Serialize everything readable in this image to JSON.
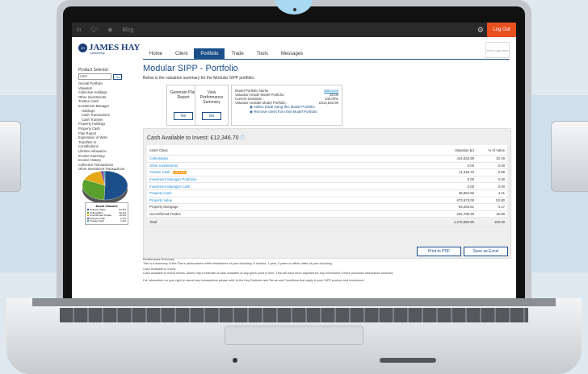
{
  "topbar": {
    "blog": "Blog",
    "logout": "Log Out",
    "social_icons": [
      "in",
      "twitter",
      "instagram"
    ]
  },
  "brand": {
    "name": "JAMES HAY",
    "sub": "partnership",
    "badge": "JH"
  },
  "nav": {
    "tabs": [
      "Home",
      "Client",
      "Portfolio",
      "Trade",
      "Tools",
      "Messages"
    ],
    "active": "Portfolio"
  },
  "your_logo": "Your Logo Here",
  "sidebar": {
    "product_selector_label": "Product Selector:",
    "selected_product": "SIPP",
    "go": "Go",
    "items": [
      {
        "label": "Overall Portfolio",
        "indent": false
      },
      {
        "label": "Valuation",
        "indent": false
      },
      {
        "label": "Collective Holdings",
        "indent": false
      },
      {
        "label": "Other Investments",
        "indent": false
      },
      {
        "label": "Trustee Cash",
        "indent": false
      },
      {
        "label": "Investment Manager",
        "indent": false
      },
      {
        "label": "Holdings",
        "indent": true
      },
      {
        "label": "Cash Transactions",
        "indent": true
      },
      {
        "label": "Cash Transfer",
        "indent": true
      },
      {
        "label": "Property Holdings",
        "indent": false
      },
      {
        "label": "Property Cash",
        "indent": false
      },
      {
        "label": "Plan Report",
        "indent": false
      },
      {
        "label": "Expression of Wish",
        "indent": false
      },
      {
        "label": "Transfers In",
        "indent": false
      },
      {
        "label": "Contributions",
        "indent": false
      },
      {
        "label": "Lifetime Allowance",
        "indent": false
      },
      {
        "label": "Income Summary",
        "indent": false
      },
      {
        "label": "Income History",
        "indent": false
      },
      {
        "label": "Collective Transactions",
        "indent": false
      },
      {
        "label": "Other Investment Transactions",
        "indent": false
      }
    ],
    "asset_classes": {
      "title": "Asset Classes",
      "rows": [
        {
          "label": "Property Value",
          "value": "52.8%",
          "color": "#1b4f8a"
        },
        {
          "label": "Collectables",
          "value": "32.4%",
          "color": "#5aa02c"
        },
        {
          "label": "Unconfirmed Trades",
          "value": "15.9%",
          "color": "#e6a817"
        },
        {
          "label": "Property Cash",
          "value": "2.1%",
          "color": "#7b3fa0"
        },
        {
          "label": "Trustee Cash",
          "value": "1.0%",
          "color": "#2aa7a0"
        }
      ]
    }
  },
  "main": {
    "title": "Modular SIPP - Portfolio",
    "subtitle": "Below is the valuation summary for the Modular SIPP portfolio.",
    "cards": [
      {
        "label": "Generate Plan Report",
        "button": "Go"
      },
      {
        "label": "View Performance Summary",
        "button": "Go"
      }
    ],
    "model_portfolio": {
      "rows": [
        {
          "label": "Model Portfolio Name :",
          "value": "Balanced"
        },
        {
          "label": "Valuation Inside Model Portfolio :",
          "value": "£0.00"
        },
        {
          "label": "Current Deviation :",
          "value": "100.00%"
        },
        {
          "label": "Valuation outside Model Portfolio :",
          "value": "£614,532.90"
        }
      ],
      "links": [
        "Adhoc trade using this Model Portfolio",
        "Remove client from this Model Portfolio"
      ]
    },
    "cash_available": "Cash Available to Invest: £12,346.70",
    "table": {
      "headers": [
        "Asset Class",
        "Valuation (£)",
        "% of Value"
      ],
      "rows": [
        {
          "asset": "Collectables",
          "valuation": "414,532.90",
          "pct": "32.49",
          "link": true,
          "badge": ""
        },
        {
          "asset": "Other Investments",
          "valuation": "0.00",
          "pct": "0.00",
          "link": true,
          "badge": ""
        },
        {
          "asset": "Trustee Cash",
          "valuation": "11,346.70",
          "pct": "0.89",
          "link": true,
          "badge": "Alert Me"
        },
        {
          "asset": "Investment Manager Portfolios",
          "valuation": "0.00",
          "pct": "0.00",
          "link": true,
          "badge": ""
        },
        {
          "asset": "Investment Manager Cash",
          "valuation": "0.00",
          "pct": "0.00",
          "link": true,
          "badge": ""
        },
        {
          "asset": "Property Cash",
          "valuation": "26,862.66",
          "pct": "2.11",
          "link": true,
          "badge": ""
        },
        {
          "asset": "Property Value",
          "valuation": "673,673.00",
          "pct": "52.80",
          "link": true,
          "badge": ""
        },
        {
          "asset": "Property Mortgage",
          "valuation": "-53,263.61",
          "pct": "-4.17",
          "link": false,
          "badge": ""
        },
        {
          "asset": "Unconfirmed Trades",
          "valuation": "202,799.25",
          "pct": "15.90",
          "link": false,
          "badge": ""
        }
      ],
      "total": {
        "label": "Total",
        "valuation": "1,275,950.90",
        "pct": "100.00"
      }
    },
    "buttons": {
      "print": "Print to PDF",
      "excel": "Save as Excel"
    },
    "footer": [
      "Performance Summary",
      "This is a summary of the Plan's performance within timeframes of your choosing: 6 months, 1 year, 3 years or within dates of your choosing.",
      "Cash Available to Invest",
      "Cash available to invest shows James Hay's estimate of cash available at any given point in time. This will have been adjusted for any Investment Centre purchase instructions received.",
      "For information on your right to cancel any transactions please refer to the Key Features and Terms and Conditions that apply to your SIPP product and investment."
    ]
  }
}
